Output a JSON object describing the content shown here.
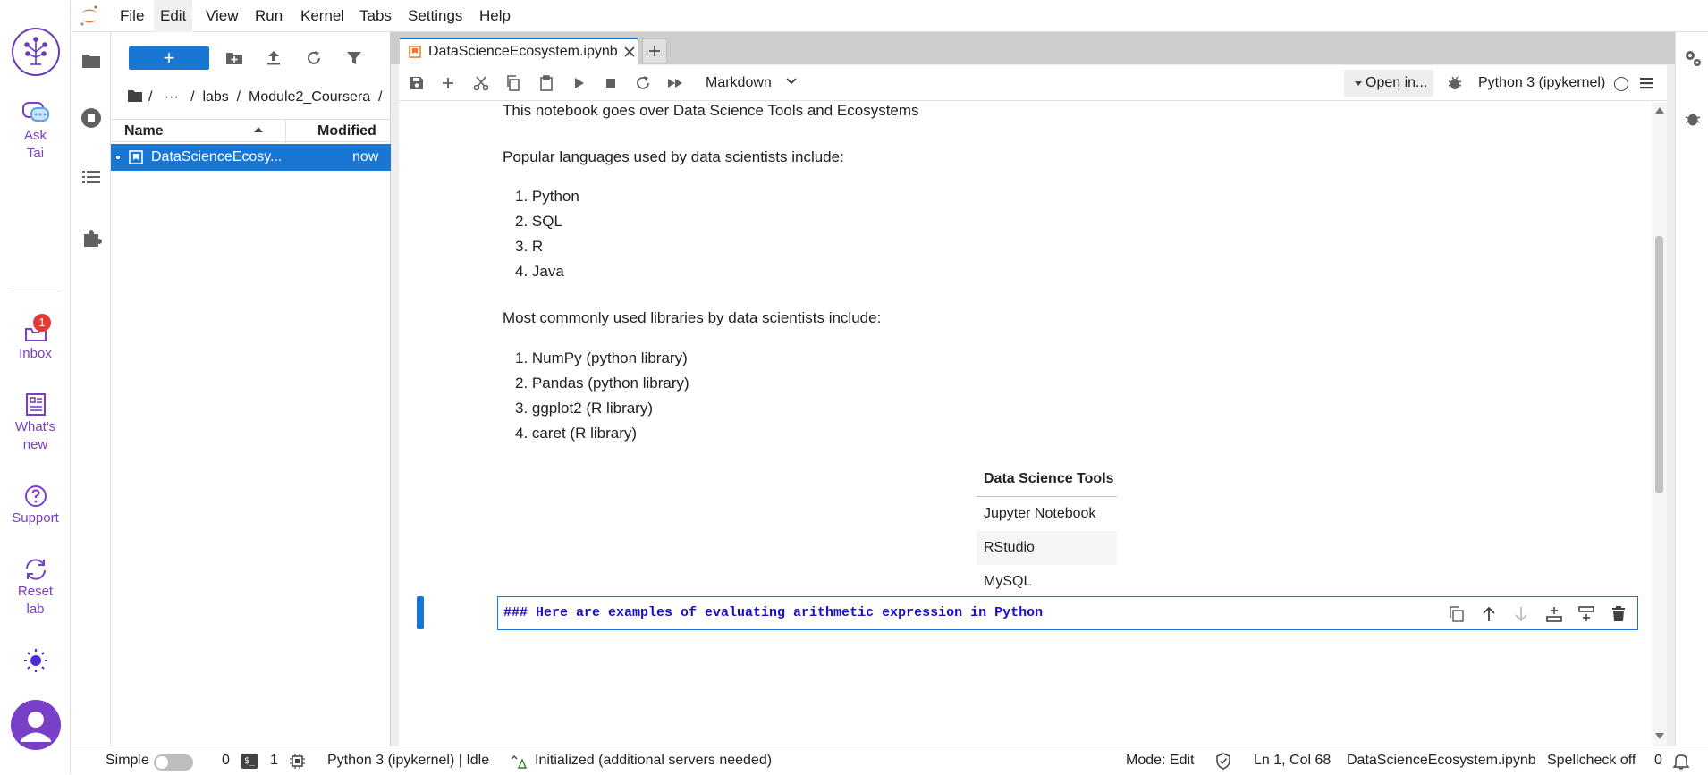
{
  "leftbar": {
    "ask_tai": "Ask\nTai",
    "inbox": "Inbox",
    "inbox_badge": "1",
    "whats_new": "What's\nnew",
    "support": "Support",
    "reset_lab": "Reset\nlab"
  },
  "menubar": {
    "items": [
      "File",
      "Edit",
      "View",
      "Run",
      "Kernel",
      "Tabs",
      "Settings",
      "Help"
    ]
  },
  "filebrowser": {
    "new_label": "+",
    "breadcrumb": "/   ···   /  labs  /  Module2_Coursera  /",
    "col_name": "Name",
    "col_modified": "Modified",
    "files": [
      {
        "name": "DataScienceEcosy...",
        "modified": "now"
      }
    ]
  },
  "notebook": {
    "tab_title": "DataScienceEcosystem.ipynb",
    "cell_type": "Markdown",
    "open_in": "Open in...",
    "kernel": "Python 3 (ipykernel)",
    "intro": "This notebook goes over Data Science Tools and Ecosystems",
    "languages_heading": "Popular languages used by data scientists include:",
    "languages": [
      "1. Python",
      "2. SQL",
      "3. R",
      "4. Java"
    ],
    "libraries_heading": "Most commonly used libraries by data scientists include:",
    "libraries": [
      "1. NumPy (python library)",
      "2. Pandas (python library)",
      "3. ggplot2 (R library)",
      "4. caret (R library)"
    ],
    "table_header": "Data Science Tools",
    "table_rows": [
      "Jupyter Notebook",
      "RStudio",
      "MySQL"
    ],
    "active_cell_source": "### Here are examples of evaluating arithmetic expression in Python"
  },
  "statusbar": {
    "simple": "Simple",
    "count1": "0",
    "count2": "1",
    "kernel_status": "Python 3 (ipykernel) | Idle",
    "lsp": "Initialized (additional servers needed)",
    "mode": "Mode: Edit",
    "position": "Ln 1, Col 68",
    "filename": "DataScienceEcosystem.ipynb",
    "spellcheck": "Spellcheck off",
    "notif_count": "0"
  },
  "colors": {
    "accent": "#1976d2",
    "tai_purple": "#7a3fc7",
    "badge_red": "#e53935",
    "code_blue": "#1a0dcc"
  }
}
